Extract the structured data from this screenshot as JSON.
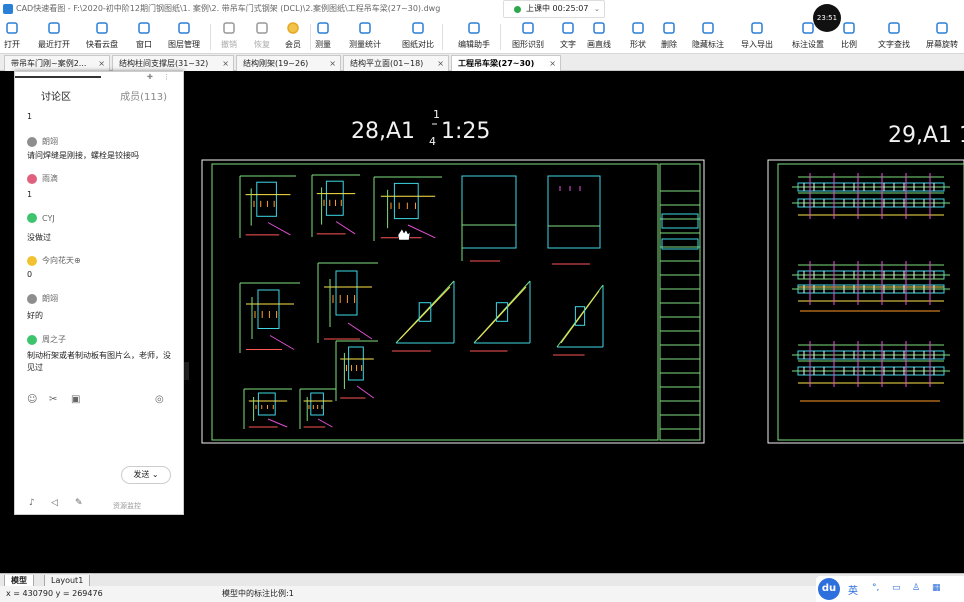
{
  "titlebar": {
    "title": "CAD快速看图 - F:\\2020-初中阶12期门钢图纸\\1. 案例\\2. 带吊车门式钢架 (DCL)\\2.案例图纸\\工程吊车梁(27~30).dwg"
  },
  "toolbar": {
    "items": [
      {
        "label": "打开",
        "icon": "folder-open-icon",
        "enabled": true
      },
      {
        "label": "最近打开",
        "icon": "clock-history-icon",
        "enabled": true
      },
      {
        "label": "快看云盘",
        "icon": "cloud-drive-icon",
        "enabled": true
      },
      {
        "label": "窗口",
        "icon": "window-select-icon",
        "enabled": true
      },
      {
        "label": "图层管理",
        "icon": "layers-icon",
        "enabled": true
      },
      {
        "label": "撤销",
        "icon": "undo-icon",
        "enabled": false
      },
      {
        "label": "恢复",
        "icon": "redo-icon",
        "enabled": false
      },
      {
        "label": "会员",
        "icon": "vip-icon",
        "enabled": true
      },
      {
        "label": "测量",
        "icon": "measure-icon",
        "enabled": true
      },
      {
        "label": "测量统计",
        "icon": "measure-stats-icon",
        "enabled": true
      },
      {
        "label": "图纸对比",
        "icon": "compare-icon",
        "enabled": true
      },
      {
        "label": "编辑助手",
        "icon": "edit-assistant-icon",
        "enabled": true
      },
      {
        "label": "图形识别",
        "icon": "shape-recognize-icon",
        "enabled": true
      },
      {
        "label": "文字",
        "icon": "text-icon",
        "enabled": true
      },
      {
        "label": "画直线",
        "icon": "line-icon",
        "enabled": true
      },
      {
        "label": "形状",
        "icon": "shape-icon",
        "enabled": true
      },
      {
        "label": "删除",
        "icon": "eraser-icon",
        "enabled": true
      },
      {
        "label": "隐藏标注",
        "icon": "hide-annotation-icon",
        "enabled": true
      },
      {
        "label": "导入导出",
        "icon": "import-export-icon",
        "enabled": true
      },
      {
        "label": "标注设置",
        "icon": "annotation-settings-icon",
        "enabled": true
      },
      {
        "label": "比例",
        "icon": "scale-icon",
        "enabled": true
      },
      {
        "label": "文字查找",
        "icon": "text-search-icon",
        "enabled": true
      },
      {
        "label": "屏幕旋转",
        "icon": "rotate-screen-icon",
        "enabled": true
      }
    ]
  },
  "tabs": [
    {
      "label": "带吊车门刚~案例2...",
      "active": false
    },
    {
      "label": "结构柱间支撑层(31~32)",
      "active": false
    },
    {
      "label": "结构刚架(19~26)",
      "active": false
    },
    {
      "label": "结构平立面(01~18)",
      "active": false
    },
    {
      "label": "工程吊车梁(27~30)",
      "active": true
    }
  ],
  "recorder": {
    "text": "上课中 00:25:07"
  },
  "timer": {
    "text": "23:51"
  },
  "chat": {
    "title": "讨论区",
    "members": "成员(113)",
    "entries": [
      {
        "kind": "msg",
        "text": "1"
      },
      {
        "kind": "user",
        "name": "朗翊",
        "color": "#8e8e8e"
      },
      {
        "kind": "msg",
        "text": "请问焊缝是刚接，螺栓是铰接吗"
      },
      {
        "kind": "user",
        "name": "雨滴",
        "color": "#e0607e"
      },
      {
        "kind": "msg",
        "text": "1"
      },
      {
        "kind": "user",
        "name": "CYJ",
        "color": "#3ec46d"
      },
      {
        "kind": "msg",
        "text": "没做过"
      },
      {
        "kind": "user",
        "name": "今向花天⊕",
        "color": "#f2c230"
      },
      {
        "kind": "msg",
        "text": "0"
      },
      {
        "kind": "user",
        "name": "朗翊",
        "color": "#8e8e8e"
      },
      {
        "kind": "msg",
        "text": "好的"
      },
      {
        "kind": "user",
        "name": "周之子",
        "color": "#3ec46d"
      },
      {
        "kind": "msg",
        "text": "制动桁架或者制动板有图片么，老师，没见过"
      }
    ],
    "tool_icons": [
      "emoji-icon",
      "scissors-icon",
      "image-icon",
      "settings-circle-icon"
    ],
    "send_label": "发送",
    "bottom_icons": [
      "microphone-icon",
      "speaker-icon",
      "pen-icon"
    ],
    "resource_label": "资源监控"
  },
  "drawing": {
    "title_left_num": "28,A1",
    "title_left_scale": "1:25",
    "title_left_frac_top": "1",
    "title_left_frac_bot": "4",
    "title_right": "29,A1 1:"
  },
  "layout_tabs": [
    {
      "label": "模型",
      "active": true
    },
    {
      "label": "Layout1",
      "active": false
    }
  ],
  "status": {
    "coords": "x = 430790  y = 269476",
    "scale_text": "模型中的标注比例:1"
  },
  "tray": {
    "du_label": "du",
    "lang_label": "英",
    "icons": [
      "punctuation-icon",
      "keyboard-icon",
      "shirt-icon",
      "grid-icon"
    ]
  }
}
